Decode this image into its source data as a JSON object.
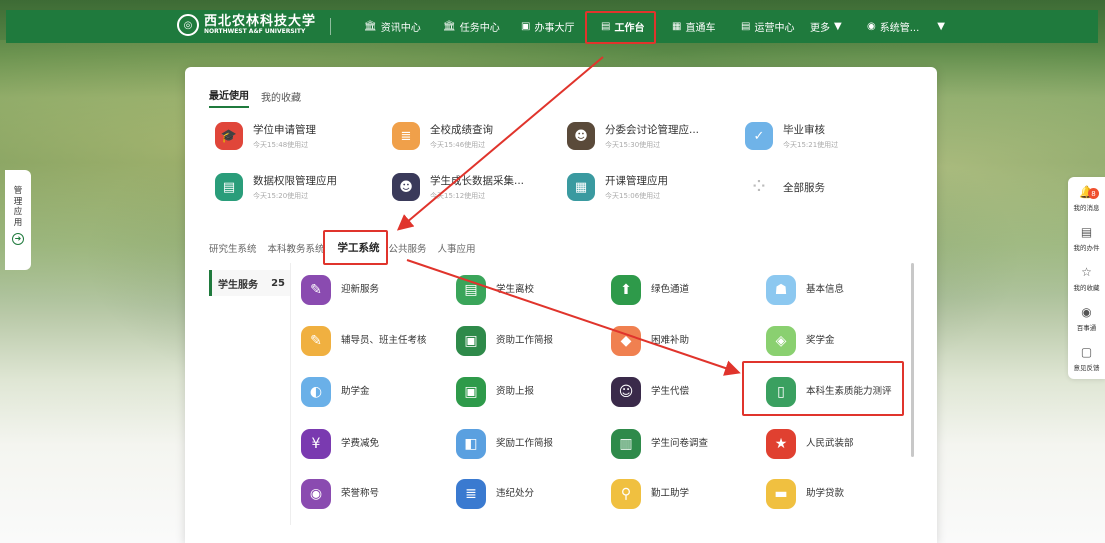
{
  "header": {
    "logo_cn": "西北农林科技大学",
    "logo_en": "NORTHWEST A&F UNIVERSITY",
    "nav": [
      {
        "label": "资讯中心",
        "icon": "building-icon"
      },
      {
        "label": "任务中心",
        "icon": "building-icon"
      },
      {
        "label": "办事大厅",
        "icon": "monitor-icon"
      },
      {
        "label": "工作台",
        "icon": "document-icon"
      },
      {
        "label": "直通车",
        "icon": "list-icon"
      },
      {
        "label": "运营中心",
        "icon": "document-icon"
      },
      {
        "label": "更多",
        "icon": "chevron-down-icon"
      }
    ],
    "user": "系统管..."
  },
  "panel": {
    "tabs": [
      "最近使用",
      "我的收藏"
    ],
    "recent": [
      {
        "title": "学位申请管理",
        "sub": "今天15:48使用过",
        "color": "#e0463a",
        "glyph": "🎓"
      },
      {
        "title": "全校成绩查询",
        "sub": "今天15:46使用过",
        "color": "#f0a04a",
        "glyph": "≣"
      },
      {
        "title": "分委会讨论管理应...",
        "sub": "今天15:30使用过",
        "color": "#5a4a3a",
        "glyph": "👤"
      },
      {
        "title": "毕业审核",
        "sub": "今天15:21使用过",
        "color": "#6fb3e8",
        "glyph": "✓"
      },
      {
        "title": "数据权限管理应用",
        "sub": "今天15:20使用过",
        "color": "#2a9d7a",
        "glyph": "▤"
      },
      {
        "title": "学生成长数据采集...",
        "sub": "今天15:12使用过",
        "color": "#3a3a5a",
        "glyph": "👤"
      },
      {
        "title": "开课管理应用",
        "sub": "今天15:06使用过",
        "color": "#3a9aa0",
        "glyph": "▦"
      },
      {
        "title": "全部服务",
        "sub": "",
        "color": "#ffffff",
        "glyph": "⚇"
      }
    ],
    "systems": [
      "研究生系统",
      "本科教务系统",
      "学工系统",
      "公共服务",
      "人事应用"
    ],
    "category": {
      "label": "学生服务",
      "count": "25"
    },
    "services": [
      {
        "label": "迎新服务",
        "color": "#8a4bb0",
        "glyph": "✎"
      },
      {
        "label": "学生离校",
        "color": "#3aa55a",
        "glyph": "▤"
      },
      {
        "label": "绿色通道",
        "color": "#2e9a4a",
        "glyph": "⬆"
      },
      {
        "label": "基本信息",
        "color": "#8cc8f0",
        "glyph": "☗"
      },
      {
        "label": "辅导员、班主任考核",
        "color": "#f0b040",
        "glyph": "✎"
      },
      {
        "label": "资助工作简报",
        "color": "#2e8a4a",
        "glyph": "▣"
      },
      {
        "label": "困难补助",
        "color": "#f08050",
        "glyph": "◆"
      },
      {
        "label": "奖学金",
        "color": "#8ad070",
        "glyph": "◈"
      },
      {
        "label": "助学金",
        "color": "#6ab0e8",
        "glyph": "◐"
      },
      {
        "label": "资助上报",
        "color": "#2e9a4a",
        "glyph": "▣"
      },
      {
        "label": "学生代偿",
        "color": "#3a2a4a",
        "glyph": "☺"
      },
      {
        "label": "本科生素质能力测评",
        "color": "#3aa060",
        "glyph": "▯"
      },
      {
        "label": "学费减免",
        "color": "#7a3ab0",
        "glyph": "¥"
      },
      {
        "label": "奖励工作简报",
        "color": "#5aa0e0",
        "glyph": "◧"
      },
      {
        "label": "学生问卷调查",
        "color": "#2e8a4a",
        "glyph": "▥"
      },
      {
        "label": "人民武装部",
        "color": "#e04030",
        "glyph": "★"
      },
      {
        "label": "荣誉称号",
        "color": "#8a4bb0",
        "glyph": "◉"
      },
      {
        "label": "违纪处分",
        "color": "#3a7ad0",
        "glyph": "≣"
      },
      {
        "label": "勤工助学",
        "color": "#f0c040",
        "glyph": "⚲"
      },
      {
        "label": "助学贷款",
        "color": "#f0c040",
        "glyph": "▬"
      }
    ]
  },
  "left_tab": {
    "chars": [
      "管",
      "理",
      "应",
      "用"
    ]
  },
  "right_bar": [
    {
      "label": "我的消息",
      "badge": "8",
      "glyph": "🔔"
    },
    {
      "label": "我的办件",
      "glyph": "▤"
    },
    {
      "label": "我的收藏",
      "glyph": "☆"
    },
    {
      "label": "百事通",
      "glyph": "◉"
    },
    {
      "label": "意见反馈",
      "glyph": "▢"
    }
  ],
  "colors": {
    "primary": "#1f7a3d",
    "highlight": "#e0342c"
  }
}
